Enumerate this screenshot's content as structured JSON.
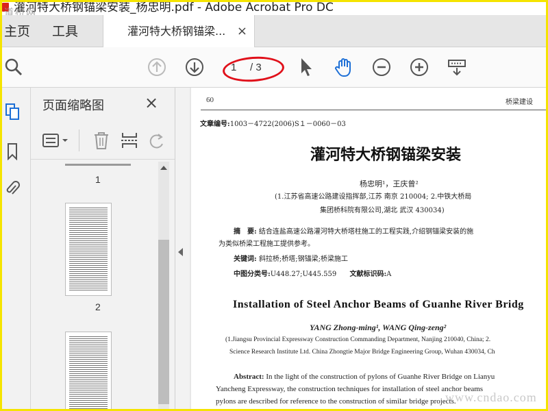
{
  "window": {
    "title": "灌河特大桥钢锚梁安装_杨忠明.pdf - Adobe Acrobat Pro DC"
  },
  "watermarks": {
    "top_left": "道桥网",
    "bottom_right": "www.cndao.com"
  },
  "tabs": {
    "home": "主页",
    "tools": "工具",
    "document": "灌河特大桥钢锚梁...",
    "close": "×"
  },
  "toolbar": {
    "current_page": "1",
    "page_total": "/ 3",
    "icons": [
      "search-icon",
      "page-up-icon",
      "page-down-icon",
      "select-cursor-icon",
      "hand-tool-icon",
      "zoom-out-icon",
      "zoom-in-icon",
      "scroll-mode-icon"
    ]
  },
  "thumbnails": {
    "title": "页面缩略图",
    "close": "×",
    "pages": [
      "1",
      "2"
    ]
  },
  "document": {
    "header_left": "60",
    "header_right": "桥梁建设",
    "article_no_label": "文章编号:",
    "article_no": "1003－4722(2006)S１－0060－03",
    "title_cn": "灌河特大桥钢锚梁安装",
    "authors_cn": "杨忠明¹，王庆曾²",
    "affil_cn_1": "(1.江苏省高速公路建设指挥部,江苏 南京 210004; 2.中铁大桥局",
    "affil_cn_2": "集团桥科院有限公司,湖北 武汉 430034)",
    "abstract_label": "摘　要:",
    "abstract_cn_1": "结合连盐高速公路灌河特大桥塔柱施工的工程实践,介绍钢锚梁安装的施",
    "abstract_cn_2": "为类似桥梁工程施工提供参考。",
    "keywords_label": "关键词:",
    "keywords": "斜拉桥;桥塔;钢锚梁;桥梁施工",
    "class_label": "中图分类号:",
    "class_value": "U448.27;U445.559",
    "doc_code_label": "文献标识码:",
    "doc_code_value": "A",
    "title_en": "Installation of Steel Anchor Beams of Guanhe River Bridg",
    "authors_en": "YANG Zhong-ming¹, WANG Qing-zeng²",
    "affil_en_1": "(1.Jiangsu Provincial Expressway Construction Commanding Department, Nanjing 210040, China; 2.",
    "affil_en_2": "Science Research Institute Ltd. China Zhongtie Major Bridge Engineering Group, Wuhan 430034, Ch",
    "abstract_en_label": "Abstract:",
    "abstract_en_1": "In the light of the construction of pylons of Guanhe River Bridge on Lianyu",
    "abstract_en_2": "Yancheng Expressway, the construction techniques for installation of steel anchor beams",
    "abstract_en_3": "pylons are described for reference to the construction of similar bridge projects."
  }
}
